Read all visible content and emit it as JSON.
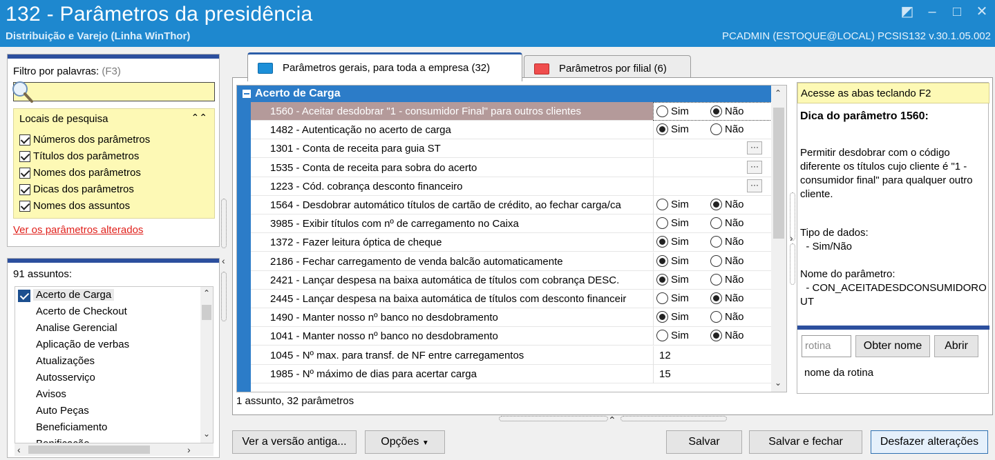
{
  "window": {
    "title": "132 - Parâmetros da presidência",
    "subtitle": "Distribuição e Varejo (Linha WinThor)",
    "user_info": "PCADMIN (ESTOQUE@LOCAL)   PCSIS132  v.30.1.05.002"
  },
  "filter": {
    "label": "Filtro por palavras:",
    "shortcut": "(F3)",
    "search_value": "",
    "locais_title": "Locais de pesquisa",
    "options": [
      {
        "label": "Números dos parâmetros",
        "checked": true
      },
      {
        "label": "Títulos dos parâmetros",
        "checked": true
      },
      {
        "label": "Nomes dos parâmetros",
        "checked": true
      },
      {
        "label": "Dicas dos parâmetros",
        "checked": true
      },
      {
        "label": "Nomes dos assuntos",
        "checked": true
      }
    ],
    "changed_link": "Ver os parâmetros alterados"
  },
  "subjects": {
    "count_label": "91 assuntos:",
    "items": [
      "Acerto de Carga",
      "Acerto de Checkout",
      "Analise Gerencial",
      "Aplicação de verbas",
      "Atualizações",
      "Autosserviço",
      "Avisos",
      "Auto Peças",
      "Beneficiamento",
      "Bonificação"
    ]
  },
  "tabs": [
    {
      "label": "Parâmetros gerais, para toda a empresa  (32)",
      "active": true
    },
    {
      "label": "Parâmetros por filial  (6)",
      "active": false
    }
  ],
  "grid": {
    "group_title": "Acerto de Carga",
    "rows": [
      {
        "label": "1560 - Aceitar desdobrar \"1 - consumidor Final\" para outros clientes",
        "type": "radio",
        "value": "Não"
      },
      {
        "label": "1482 - Autenticação no acerto de carga",
        "type": "radio",
        "value": "Sim"
      },
      {
        "label": "1301 - Conta de receita para guia ST",
        "type": "lookup"
      },
      {
        "label": "1535 - Conta de receita para sobra do acerto",
        "type": "lookup"
      },
      {
        "label": "1223 - Cód. cobrança desconto financeiro",
        "type": "lookup"
      },
      {
        "label": "1564 - Desdobrar automático títulos de cartão de crédito, ao fechar carga/ca",
        "type": "radio",
        "value": "Não"
      },
      {
        "label": "3985 - Exibir títulos com nº de carregamento no Caixa",
        "type": "radio",
        "value": "none"
      },
      {
        "label": "1372 - Fazer leitura óptica de cheque",
        "type": "radio",
        "value": "Sim"
      },
      {
        "label": "2186 - Fechar carregamento de venda balcão automaticamente",
        "type": "radio",
        "value": "Sim"
      },
      {
        "label": "2421 - Lançar despesa na baixa automática de títulos com cobrança DESC.",
        "type": "radio",
        "value": "Sim"
      },
      {
        "label": "2445 - Lançar despesa na baixa automática de títulos com desconto financeir",
        "type": "radio",
        "value": "Não"
      },
      {
        "label": "1490 - Manter nosso nº banco no desdobramento",
        "type": "radio",
        "value": "Sim"
      },
      {
        "label": "1041 - Manter nosso nº banco no desdobramento",
        "type": "radio",
        "value": "Não"
      },
      {
        "label": "1045 - Nº max. para transf. de NF entre carregamentos",
        "type": "number",
        "value": "12"
      },
      {
        "label": "1985 - Nº máximo de dias para acertar carga",
        "type": "number",
        "value": "15"
      }
    ],
    "sim_label": "Sim",
    "nao_label": "Não",
    "ellipsis": "···",
    "status": "1 assunto, 32 parâmetros"
  },
  "info": {
    "hint": "Acesse as abas teclando F2",
    "title": "Dica do parâmetro 1560:",
    "description": "Permitir desdobrar com o código diferente os títulos cujo cliente é \"1 - consumidor final\" para qualquer outro cliente.",
    "type_label": "Tipo de dados:",
    "type_value": "  - Sim/Não",
    "name_label": "Nome do parâmetro:",
    "name_value": "  - CON_ACEITADESDCONSUMIDOROUT",
    "rotina_placeholder": "rotina",
    "get_name_button": "Obter nome",
    "open_button": "Abrir",
    "rotina_name": "nome da rotina"
  },
  "buttons": {
    "old_version": "Ver a versão antiga...",
    "options": "Opções",
    "save": "Salvar",
    "save_close": "Salvar e fechar",
    "undo": "Desfazer alterações"
  },
  "colors": {
    "titlebar": "#1e88cf",
    "header_blue": "#2c7cc8",
    "panel_bar": "#2c4f9e",
    "highlight_yellow": "#fdf9b5",
    "link_red": "#e0201b"
  }
}
